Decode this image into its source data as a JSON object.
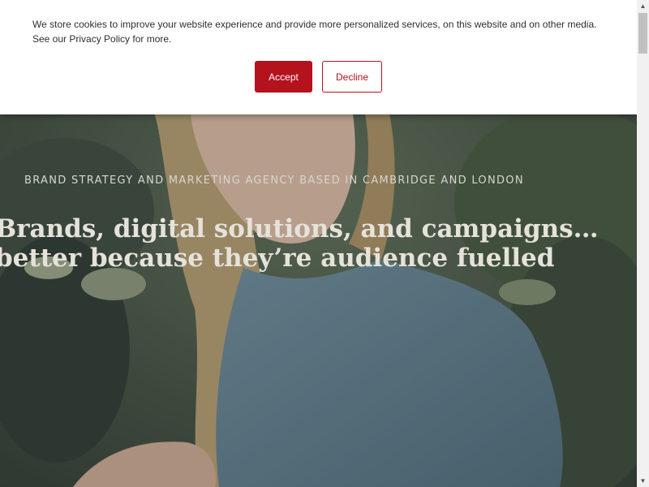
{
  "cookie_banner": {
    "message": "We store cookies to improve your website experience and provide more personalized services, on this website and on other media. See our Privacy Policy for more.",
    "accept_label": "Accept",
    "decline_label": "Decline",
    "accent_color": "#b4121d"
  },
  "hero": {
    "eyebrow": "BRAND STRATEGY AND MARKETING AGENCY BASED IN CAMBRIDGE AND LONDON",
    "headline_line1": "Brands, digital solutions, and campaigns…",
    "headline_line2": "better because they’re audience fuelled"
  },
  "scrollbar": {
    "up_icon": "chevron-up-icon",
    "down_icon": "chevron-down-icon"
  }
}
